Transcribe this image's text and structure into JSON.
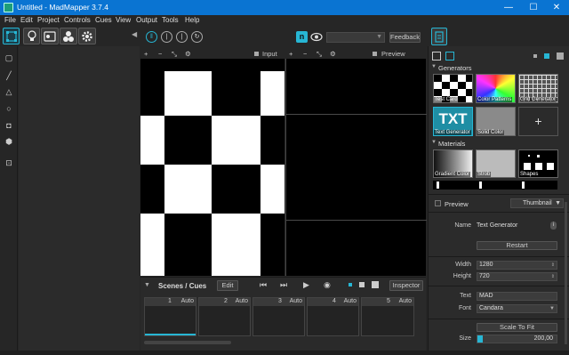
{
  "window": {
    "title": "Untitled - MadMapper 3.7.4",
    "minimize": "—",
    "maximize": "☐",
    "close": "✕"
  },
  "menu": [
    "File",
    "Edit",
    "Project",
    "Controls",
    "Cues",
    "View",
    "Output",
    "Tools",
    "Help"
  ],
  "toolbar": {
    "tools": [
      "surfaces-tool",
      "lighting-tool",
      "media-tool",
      "modules-tool",
      "settings-tool"
    ],
    "playback": [
      "pause",
      "step",
      "step2",
      "restart"
    ],
    "feedback_label": "Feedback",
    "dropdown_value": ""
  },
  "input_view": {
    "label": "Input",
    "controls": [
      "+",
      "−",
      "⤡",
      "⚙"
    ]
  },
  "output_view": {
    "label": "Preview Output",
    "controls": [
      "+",
      "−",
      "⤡",
      "⚙"
    ]
  },
  "scenes": {
    "title": "Scenes / Cues",
    "edit_label": "Edit",
    "inspector_label": "Inspector",
    "columns": [
      {
        "num": "1",
        "mode": "Auto"
      },
      {
        "num": "2",
        "mode": "Auto"
      },
      {
        "num": "3",
        "mode": "Auto"
      },
      {
        "num": "4",
        "mode": "Auto"
      },
      {
        "num": "5",
        "mode": "Auto"
      }
    ]
  },
  "generators": {
    "title": "Generators",
    "items": [
      "Test Card",
      "Color Patterns",
      "Grid Generator",
      "Text Generator",
      "Solid Color",
      "+"
    ]
  },
  "materials": {
    "title": "Materials",
    "items": [
      "Gradient Color",
      "Strob",
      "Shapes"
    ]
  },
  "inspector": {
    "preview_label": "Preview",
    "thumbnail_label": "Thumbnail",
    "name_label": "Name",
    "name_value": "Text Generator",
    "restart_label": "Restart",
    "width_label": "Width",
    "width_value": "1280",
    "height_label": "Height",
    "height_value": "720",
    "text_label": "Text",
    "text_value": "MAD",
    "font_label": "Font",
    "font_value": "Candara",
    "scale_label": "Scale To Fit",
    "size_label": "Size",
    "size_value": "200,00"
  },
  "colors": {
    "accent": "#27b6d4",
    "titlebar": "#0a74d2"
  }
}
